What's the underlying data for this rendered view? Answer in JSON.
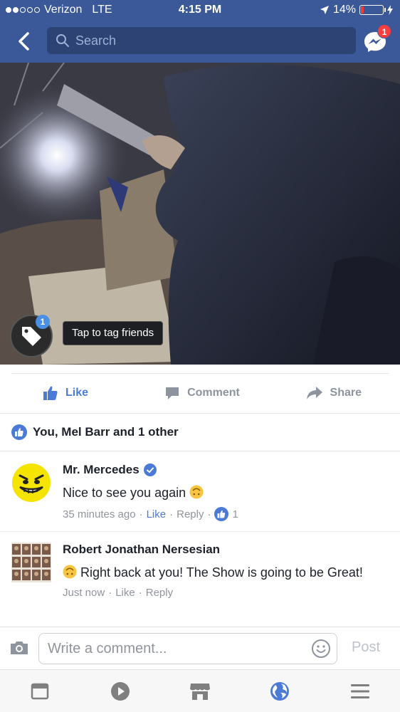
{
  "status_bar": {
    "carrier": "Verizon",
    "network": "LTE",
    "time": "4:15 PM",
    "battery": "14%",
    "battery_level": 0.14,
    "signal_bars_filled": 2,
    "signal_bars_total": 5
  },
  "nav": {
    "search_placeholder": "Search",
    "messenger_badge": "1",
    "icons": [
      "back-chevron-icon",
      "search-icon",
      "messenger-icon"
    ]
  },
  "photo": {
    "tag_badge": "1",
    "tag_tooltip": "Tap to tag friends"
  },
  "actions": {
    "like": "Like",
    "comment": "Comment",
    "share": "Share"
  },
  "likes": {
    "summary": "You, Mel Barr and 1 other"
  },
  "comments": [
    {
      "author": "Mr. Mercedes",
      "verified": true,
      "text": "Nice to see you again",
      "emoji": "upside-down-face",
      "time": "35 minutes ago",
      "like": "Like",
      "reply": "Reply",
      "like_count": "1",
      "liked": true
    },
    {
      "author": "Robert Jonathan Nersesian",
      "verified": false,
      "text": "Right back at you! The Show is going to be Great!",
      "emoji": "upside-down-face",
      "time": "Just now",
      "like": "Like",
      "reply": "Reply",
      "liked": false
    }
  ],
  "composer": {
    "placeholder": "Write a comment...",
    "post": "Post"
  },
  "tabbar": {
    "tabs": [
      "news-feed-icon",
      "video-icon",
      "marketplace-icon",
      "notifications-globe-icon",
      "menu-icon"
    ],
    "active": "notifications-globe-icon"
  },
  "colors": {
    "brand": "#3b5998",
    "accent": "#4b7bd6",
    "badge": "#fa3e3e"
  }
}
